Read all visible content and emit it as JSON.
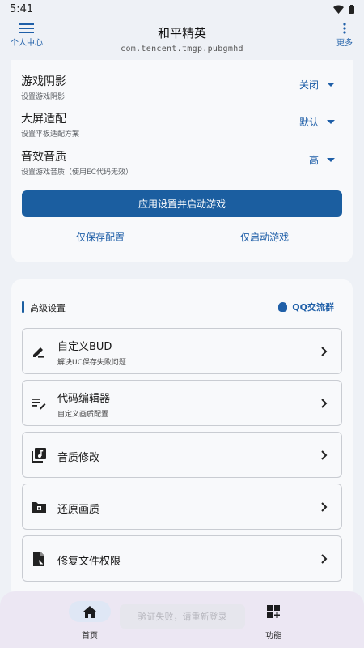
{
  "status_bar": {
    "time": "5:41"
  },
  "header": {
    "left_label": "个人中心",
    "title": "和平精英",
    "package": "com.tencent.tmgp.pubgmhd",
    "right_label": "更多"
  },
  "settings": [
    {
      "name": "游戏阴影",
      "desc": "设置游戏阴影",
      "value": "关闭"
    },
    {
      "name": "大屏适配",
      "desc": "设置平板适配方案",
      "value": "默认"
    },
    {
      "name": "音效音质",
      "desc": "设置游戏音质（使用EC代码无效）",
      "value": "高"
    }
  ],
  "actions": {
    "apply_label": "应用设置并启动游戏",
    "save_only_label": "仅保存配置",
    "launch_only_label": "仅启动游戏"
  },
  "advanced": {
    "title": "高级设置",
    "qq_label": "QQ交流群",
    "items": [
      {
        "label": "自定义BUD",
        "desc": "解决UC保存失败问题",
        "icon": "edit-pen-icon"
      },
      {
        "label": "代码编辑器",
        "desc": "自定义画质配置",
        "icon": "code-list-icon"
      },
      {
        "label": "音质修改",
        "desc": "",
        "icon": "music-library-icon"
      },
      {
        "label": "还原画质",
        "desc": "",
        "icon": "folder-restore-icon"
      },
      {
        "label": "修复文件权限",
        "desc": "",
        "icon": "file-permission-icon"
      }
    ]
  },
  "bottom_nav": {
    "home_label": "首页",
    "func_label": "功能",
    "toast": "验证失败，请重新登录"
  },
  "colors": {
    "accent": "#1b5ea0",
    "background": "#eef1f6",
    "card": "#f8f9fb",
    "nav_bar": "#ece7f3"
  }
}
